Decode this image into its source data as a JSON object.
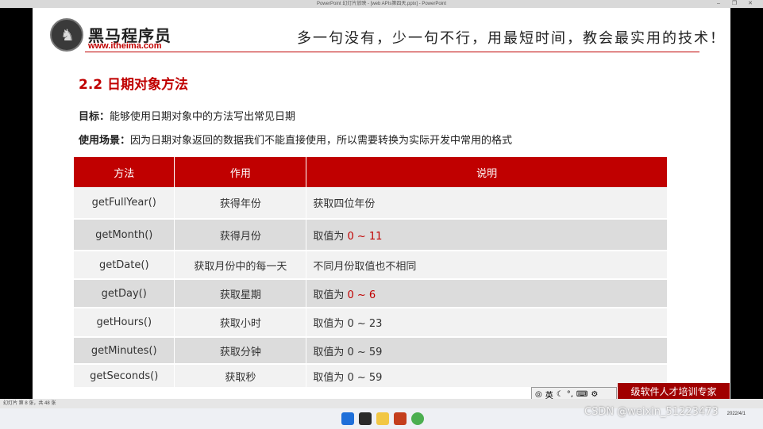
{
  "window": {
    "title": "PowerPoint 幻灯片放映 - [web APIs第四天.pptx] - PowerPoint"
  },
  "slide": {
    "brand_cn": "黑马程序员",
    "brand_url": "www.itheima.com",
    "slogan": "多一句没有，少一句不行，用最短时间，教会最实用的技术！",
    "section_title": "2.2 日期对象方法",
    "goal_label": "目标：",
    "goal_text": "能够使用日期对象中的方法写出常见日期",
    "scene_label": "使用场景：",
    "scene_text": "因为日期对象返回的数据我们不能直接使用，所以需要转换为实际开发中常用的格式",
    "table": {
      "headers": [
        "方法",
        "作用",
        "说明"
      ],
      "rows": [
        {
          "method": "getFullYear()",
          "purpose": "获得年份",
          "desc_prefix": "获取四位年份",
          "desc_value": ""
        },
        {
          "method": "getMonth()",
          "purpose": "获得月份",
          "desc_prefix": "取值为 ",
          "desc_value": "0 ~ 11"
        },
        {
          "method": "getDate()",
          "purpose": "获取月份中的每一天",
          "desc_prefix": "不同月份取值也不相同",
          "desc_value": ""
        },
        {
          "method": "getDay()",
          "purpose": "获取星期",
          "desc_prefix": "取值为 ",
          "desc_value": "0 ~ 6"
        },
        {
          "method": "getHours()",
          "purpose": "获取小时",
          "desc_prefix": "取值为 0 ~ 23",
          "desc_value": ""
        },
        {
          "method": "getMinutes()",
          "purpose": "获取分钟",
          "desc_prefix": "取值为 0 ~ 59",
          "desc_value": ""
        },
        {
          "method": "getSeconds()",
          "purpose": "获取秒",
          "desc_prefix": "取值为 0 ~ 59",
          "desc_value": ""
        }
      ]
    },
    "banner_text": "级软件人才培训专家"
  },
  "ime": {
    "lang": "英"
  },
  "status_bar": {
    "slide_info": "幻灯片 第 8 张，共 48 张"
  },
  "taskbar": {
    "date": "2022/4/1"
  },
  "watermark": "CSDN @weixin_51223473",
  "colors": {
    "accent": "#c00000",
    "row_light": "#f2f2f2",
    "row_dark": "#dcdcdc"
  }
}
